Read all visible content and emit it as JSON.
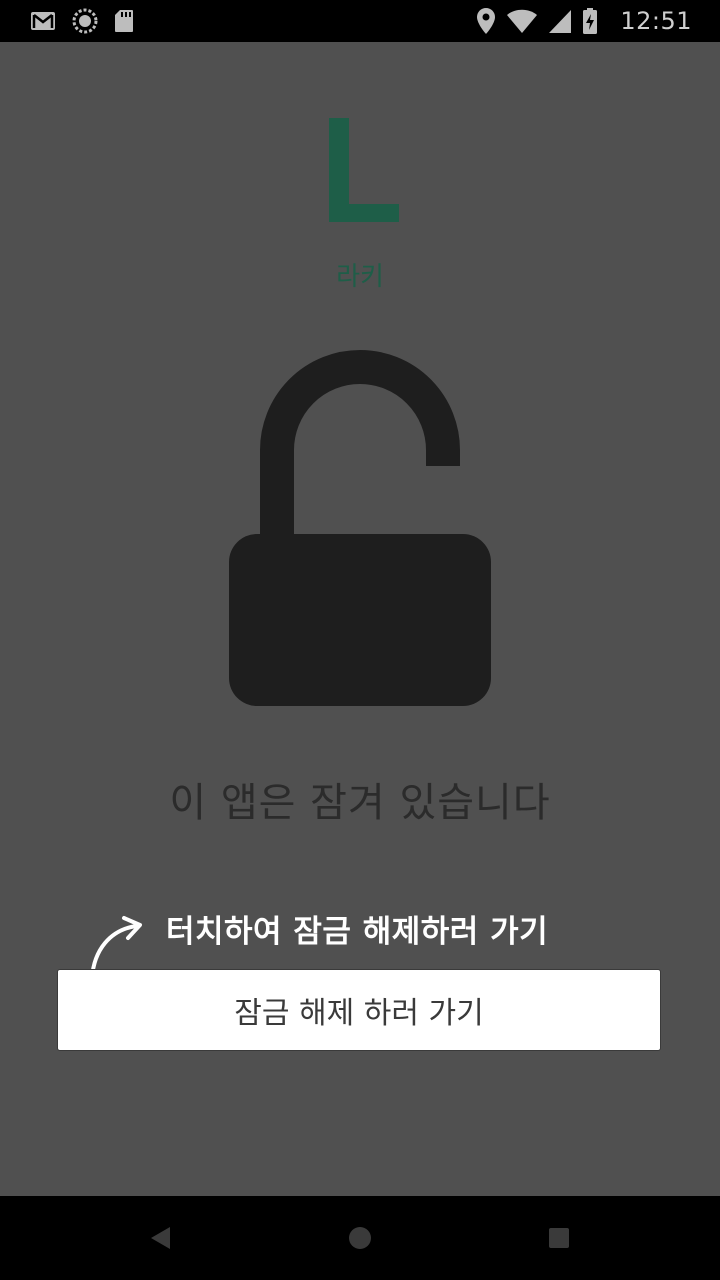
{
  "status_bar": {
    "time": "12:51",
    "left_icons": [
      "gmail-icon",
      "sync-icon",
      "sd-card-icon"
    ],
    "right_icons": [
      "location-icon",
      "wifi-icon",
      "signal-icon",
      "battery-charging-icon"
    ]
  },
  "app": {
    "logo_letter": "L",
    "name": "라키",
    "accent_color": "#1e5e48"
  },
  "lock_screen": {
    "icon": "unlocked-padlock-icon",
    "message": "이 앱은 잠겨 있습니다",
    "hint": "터치하여 잠금 해제하러 가기",
    "button_label": "잠금 해제 하러 가기"
  },
  "nav_bar": {
    "buttons": [
      "back-icon",
      "home-icon",
      "recents-icon"
    ]
  }
}
